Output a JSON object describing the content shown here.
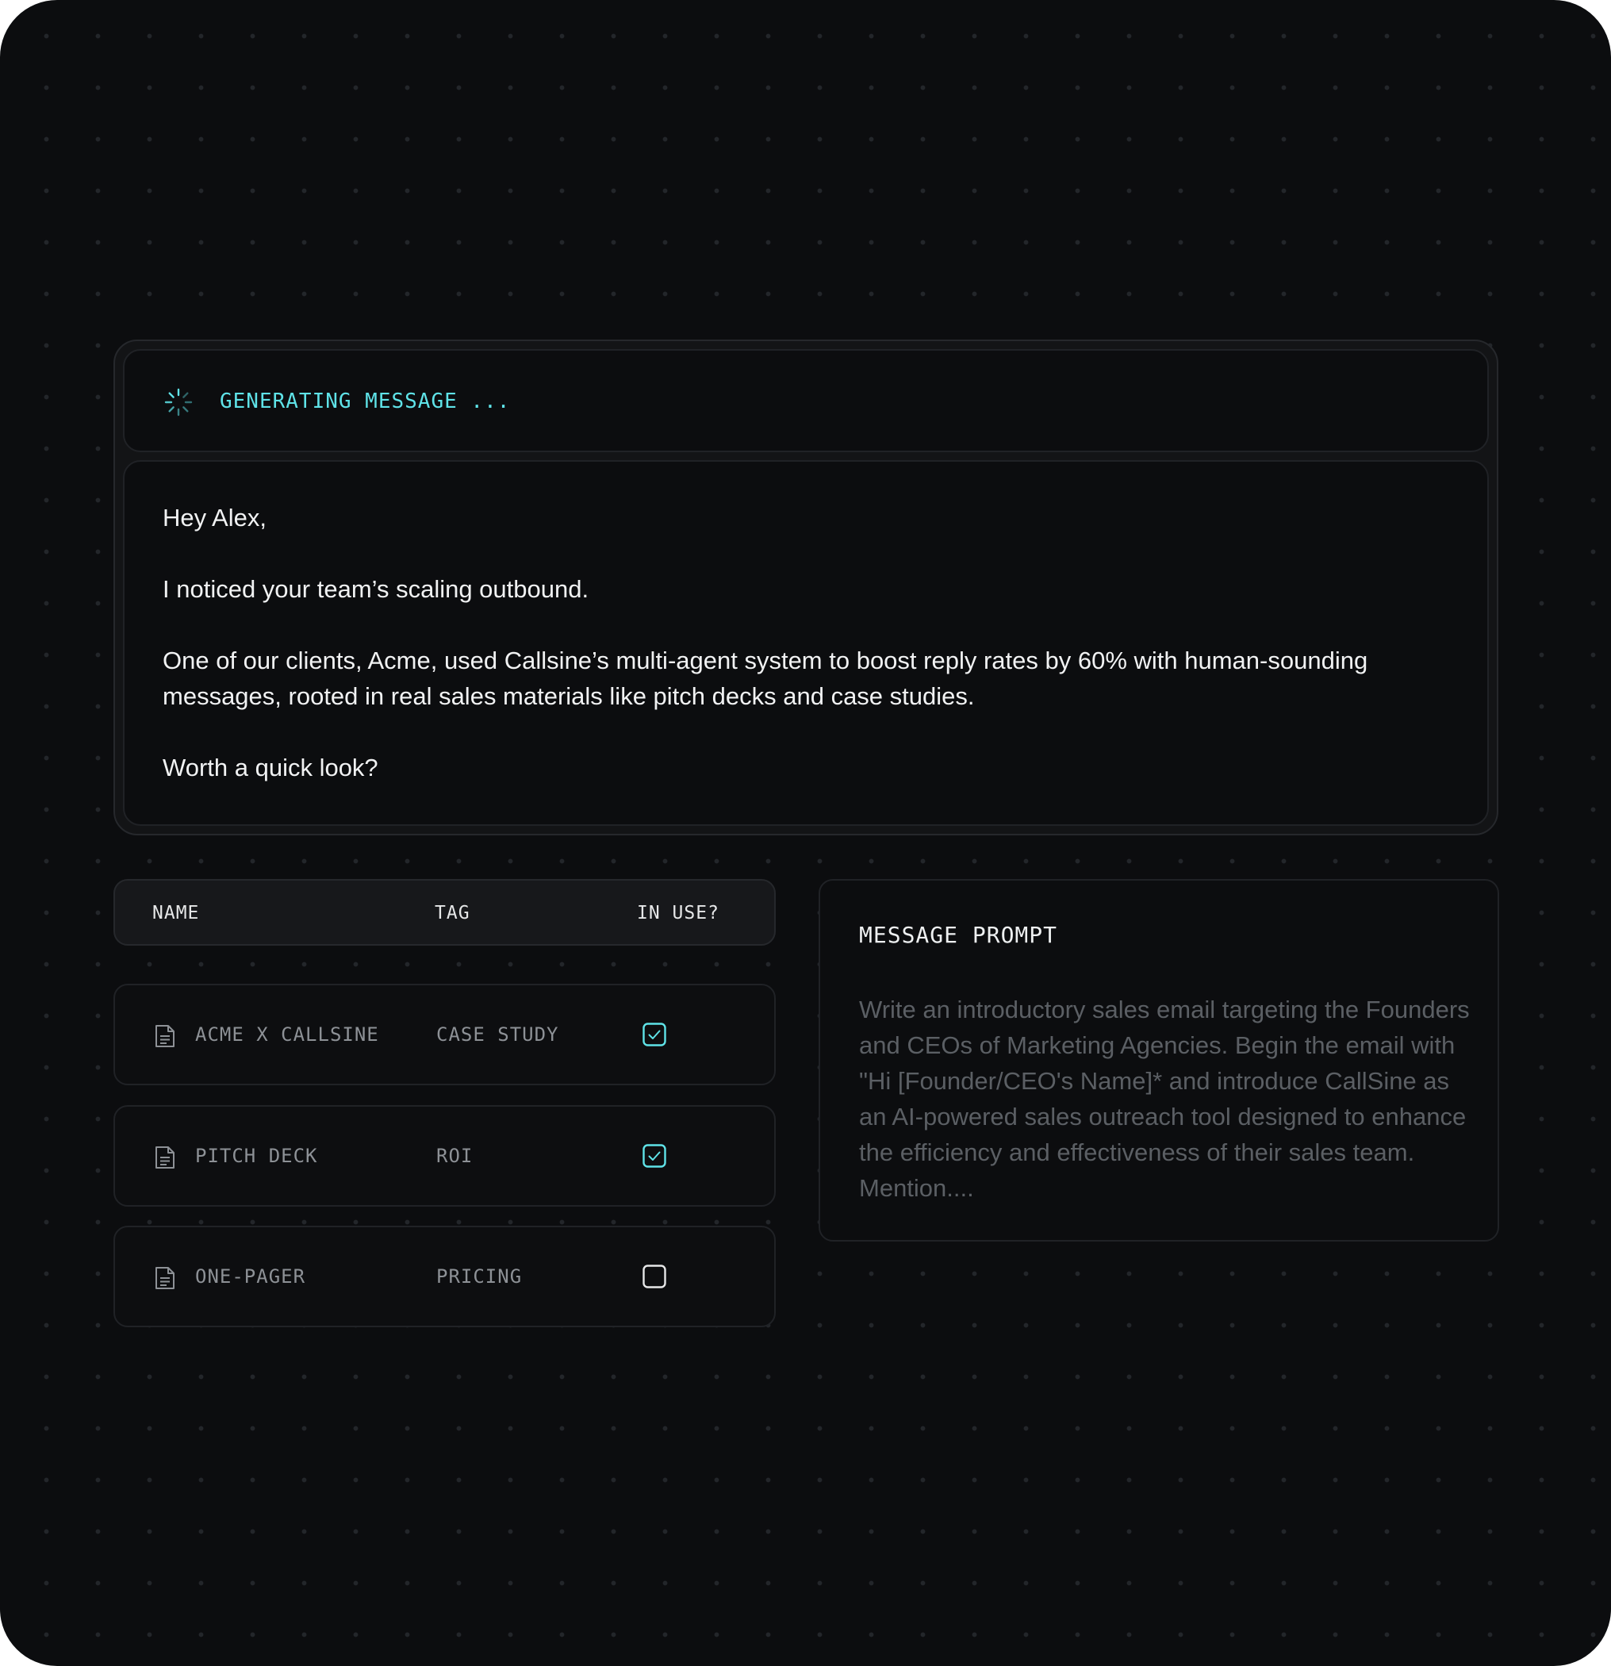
{
  "status": {
    "text": "GENERATING MESSAGE ...",
    "accent_color": "#5fe3e8",
    "icon": "spinner-icon"
  },
  "message": {
    "greeting": "Hey Alex,",
    "paragraph_1": "I noticed your team’s scaling outbound.",
    "paragraph_2": "One of our clients, Acme, used Callsine’s multi-agent system to boost reply rates by 60% with human-sounding messages, rooted in real sales materials like pitch decks and case studies.",
    "closing": "Worth a quick look?"
  },
  "table": {
    "headers": {
      "name": "NAME",
      "tag": "TAG",
      "in_use": "IN USE?"
    },
    "rows": [
      {
        "name": "ACME X CALLSINE",
        "tag": "CASE STUDY",
        "in_use": true,
        "icon": "document-icon"
      },
      {
        "name": "PITCH DECK",
        "tag": "ROI",
        "in_use": true,
        "icon": "document-icon"
      },
      {
        "name": "ONE-PAGER",
        "tag": "PRICING",
        "in_use": false,
        "icon": "document-icon"
      }
    ]
  },
  "prompt": {
    "title": "MESSAGE PROMPT",
    "body": "Write an introductory sales email targeting the Founders and CEOs of Marketing Agencies. Begin the email with \"Hi [Founder/CEO's Name]* and introduce CallSine as an AI-powered sales outreach tool designed to enhance the efficiency and effectiveness of their sales team. Mention...."
  },
  "colors": {
    "background": "#0c0d0f",
    "accent": "#5fe3e8",
    "muted_text": "#8d9196"
  }
}
